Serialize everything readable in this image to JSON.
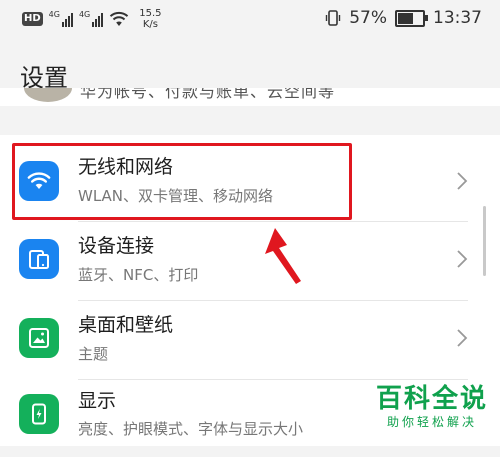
{
  "status_bar": {
    "hd": "HD",
    "sim1_gen": "4G",
    "sim2_gen": "4G",
    "speed_value": "15.5",
    "speed_unit": "K/s",
    "battery_percent": "57%",
    "battery_level": 0.57,
    "time": "13:37"
  },
  "header": {
    "title": "设置"
  },
  "profile_row_partial": {
    "text": "华为帐号、付款与账单、云空间等"
  },
  "settings": [
    {
      "title": "无线和网络",
      "subtitle": "WLAN、双卡管理、移动网络",
      "icon": "wifi-icon",
      "color": "#1a84f0"
    },
    {
      "title": "设备连接",
      "subtitle": "蓝牙、NFC、打印",
      "icon": "device-connection-icon",
      "color": "#1a84f0"
    },
    {
      "title": "桌面和壁纸",
      "subtitle": "主题",
      "icon": "wallpaper-icon",
      "color": "#14b05b"
    },
    {
      "title": "显示",
      "subtitle": "亮度、护眼模式、字体与显示大小",
      "icon": "display-icon",
      "color": "#14b05b"
    }
  ],
  "annotation": {
    "highlight_color": "#e0171f"
  },
  "watermark": {
    "big": "百科全说",
    "small": "助你轻松解决"
  }
}
